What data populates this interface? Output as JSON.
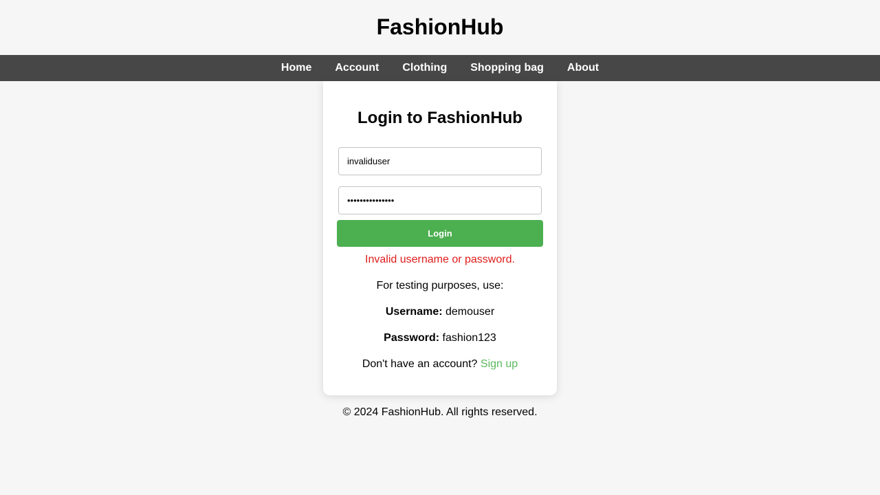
{
  "header": {
    "title": "FashionHub"
  },
  "nav": {
    "items": [
      {
        "label": "Home"
      },
      {
        "label": "Account"
      },
      {
        "label": "Clothing"
      },
      {
        "label": "Shopping bag"
      },
      {
        "label": "About"
      }
    ]
  },
  "login": {
    "heading": "Login to FashionHub",
    "username_value": "invaliduser",
    "password_value": "•••••••••••••••",
    "button_label": "Login",
    "error": "Invalid username or password.",
    "testing_note": "For testing purposes, use:",
    "username_label": "Username:",
    "username_hint": "demouser",
    "password_label": "Password:",
    "password_hint": "fashion123",
    "signup_prompt": "Don't have an account?",
    "signup_link": "Sign up"
  },
  "footer": {
    "text": "© 2024 FashionHub. All rights reserved."
  },
  "colors": {
    "nav_background": "#474747",
    "primary_button": "#4caf50",
    "error_text": "#e01b1b",
    "link": "#5cb85c",
    "page_background": "#f6f6f6"
  }
}
